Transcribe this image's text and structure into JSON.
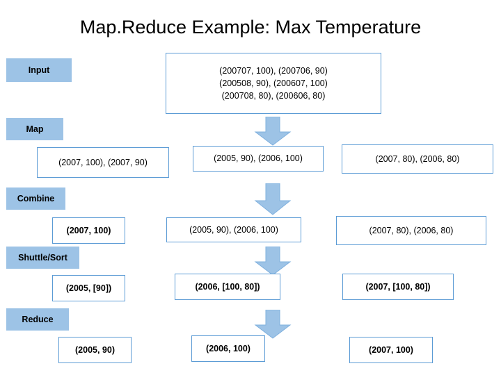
{
  "title": "Map.Reduce Example: Max Temperature",
  "stage_labels": {
    "input": "Input",
    "map": "Map",
    "combine": "Combine",
    "shuffle_sort": "Shuttle/Sort",
    "reduce": "Reduce"
  },
  "input_box": {
    "lines": [
      "(200707, 100), (200706, 90)",
      "(200508, 90), (200607, 100)",
      "(200708, 80), (200606, 80)"
    ]
  },
  "map_row": [
    "(2007, 100), (2007, 90)",
    "(2005, 90), (2006, 100)",
    "(2007, 80), (2006, 80)"
  ],
  "combine_row": [
    "(2007, 100)",
    "(2005, 90), (2006, 100)",
    "(2007, 80), (2006, 80)"
  ],
  "shuffle_row": [
    "(2005, [90])",
    "(2006, [100, 80])",
    "(2007, [100, 80])"
  ],
  "reduce_row": [
    "(2005, 90)",
    "(2006, 100)",
    "(2007, 100)"
  ],
  "colors": {
    "label_fill": "#9dc3e6",
    "box_border": "#5b9bd5",
    "arrow_fill": "#9dc3e6",
    "arrow_stroke": "#7fb0de"
  }
}
